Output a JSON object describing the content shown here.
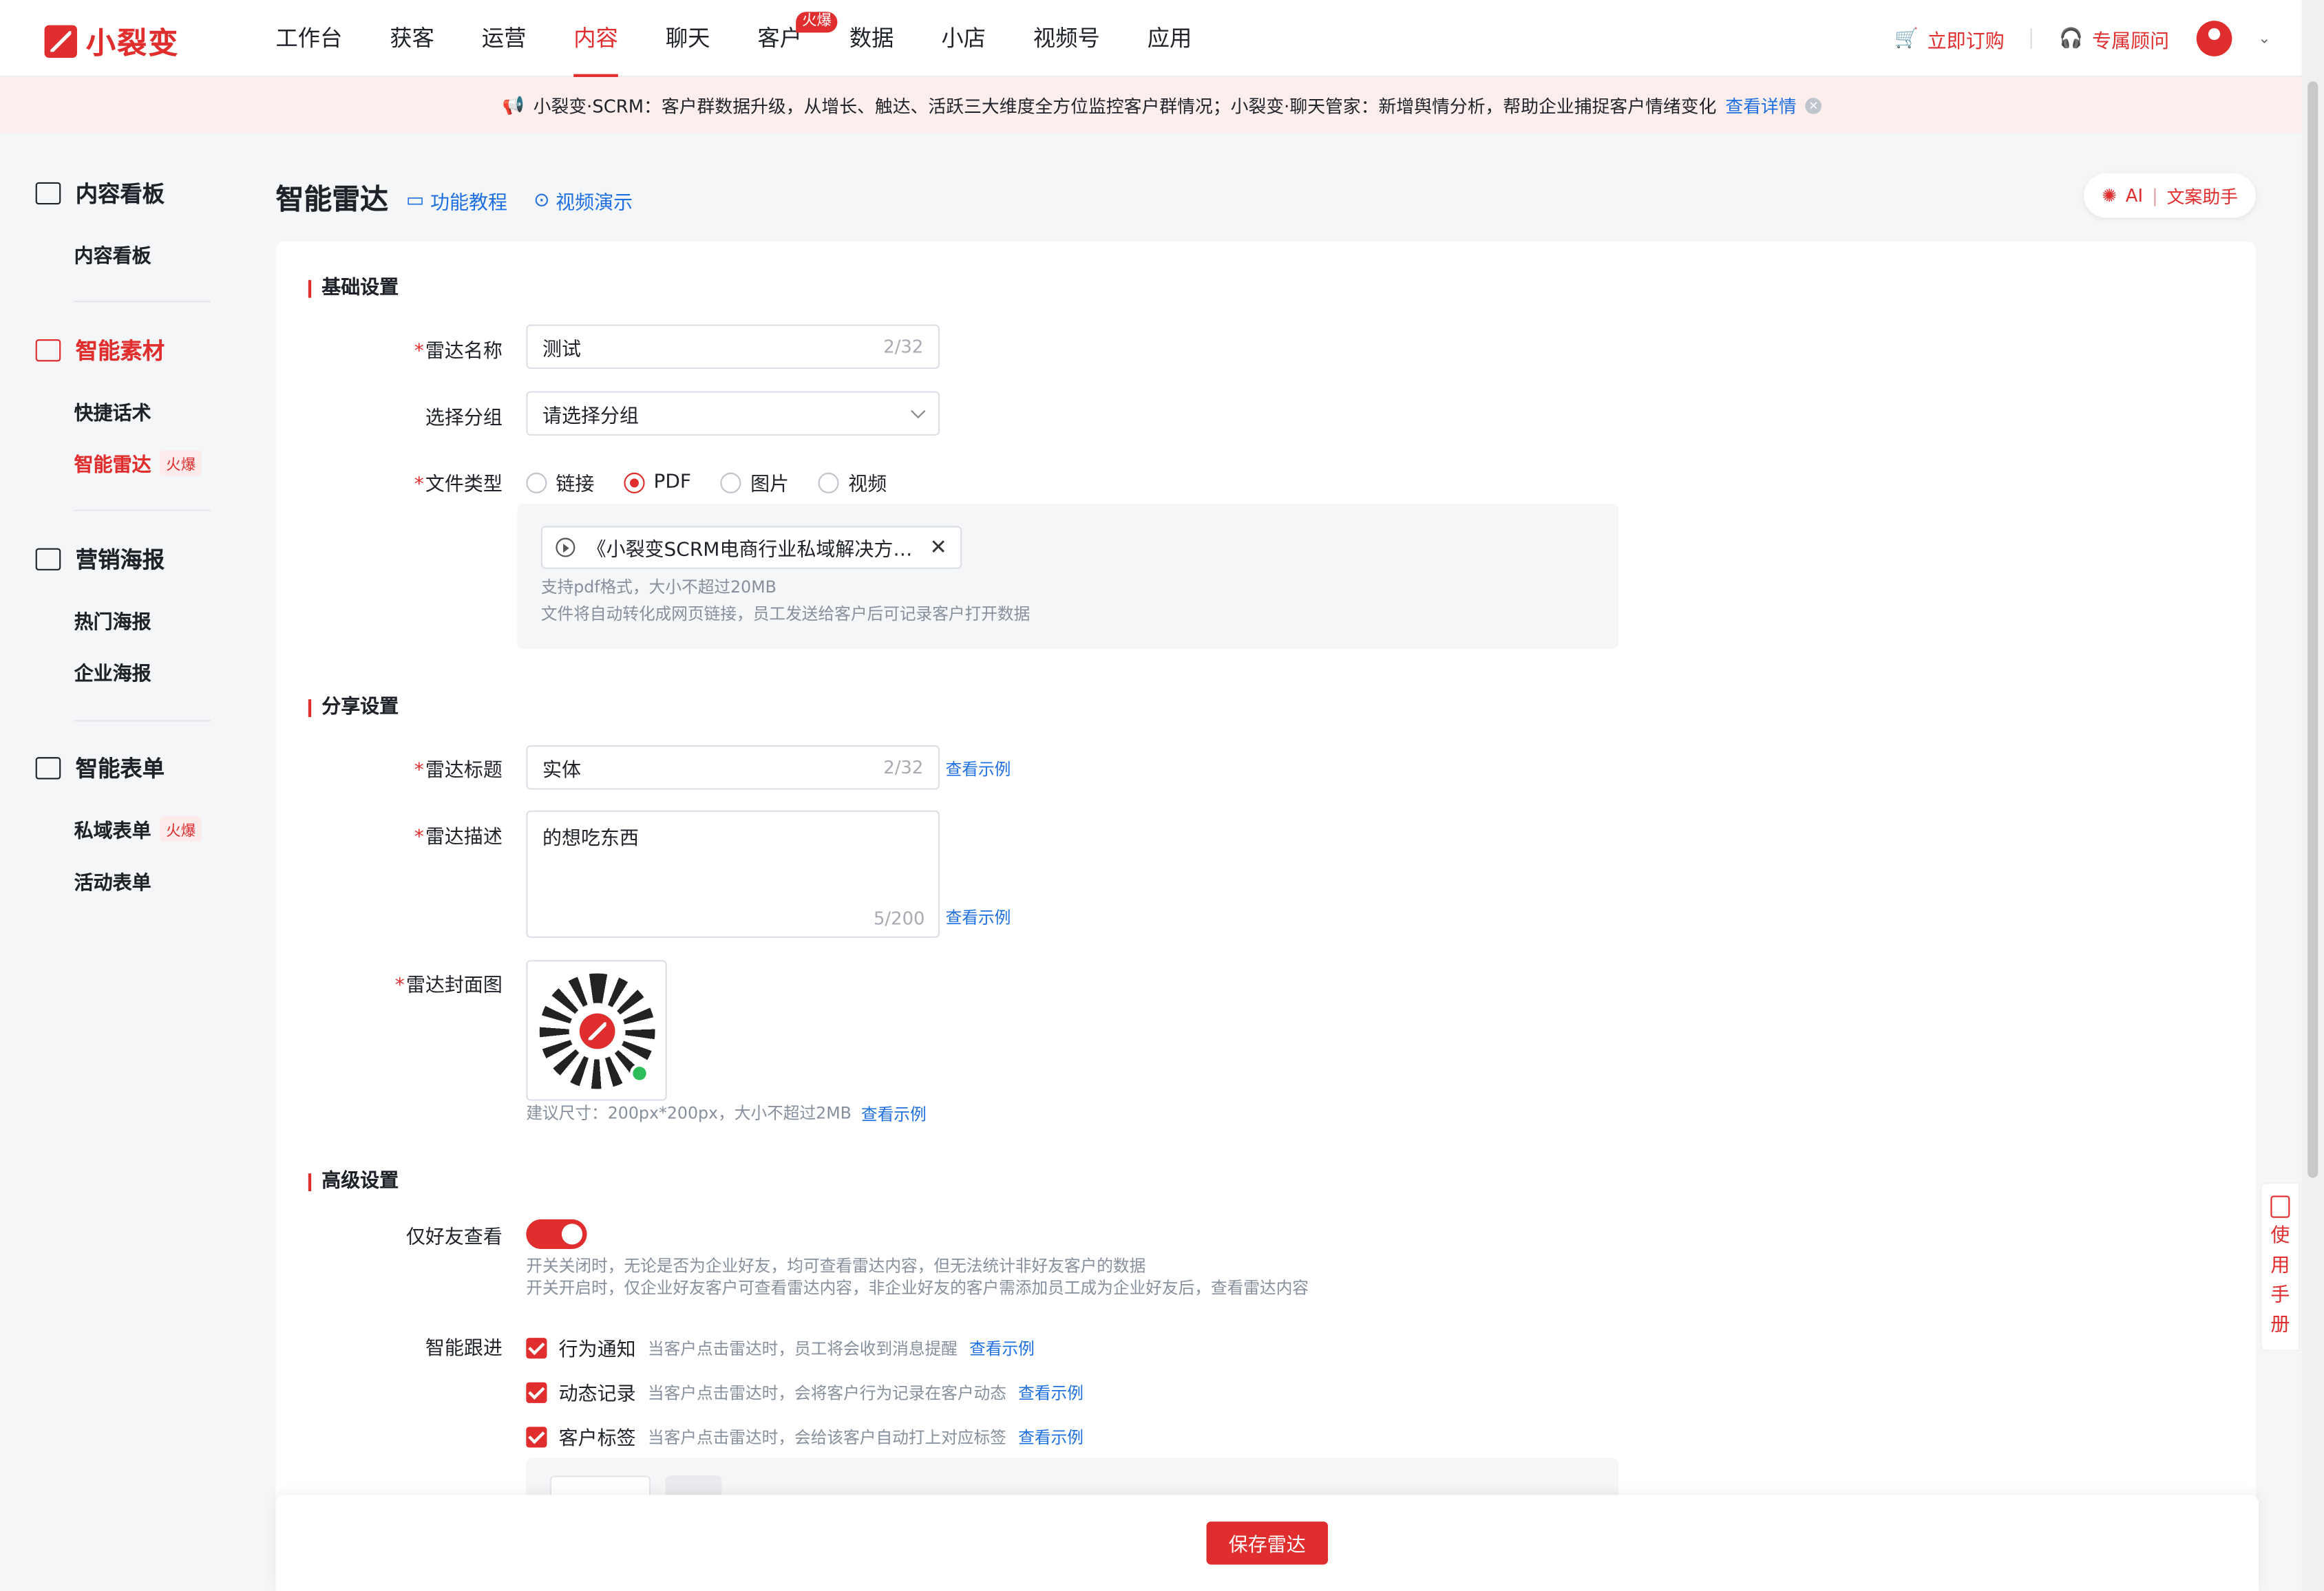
{
  "brand": {
    "name": "小裂变"
  },
  "nav": {
    "items": [
      "工作台",
      "获客",
      "运营",
      "内容",
      "聊天",
      "客户",
      "数据",
      "小店",
      "视频号",
      "应用"
    ],
    "active_index": 3,
    "hot_badge": "火爆"
  },
  "top_right": {
    "order": "立即订购",
    "advisor": "专属顾问"
  },
  "notice": {
    "text": "小裂变·SCRM：客户群数据升级，从增长、触达、活跃三大维度全方位监控客户群情况；小裂变·聊天管家：新增舆情分析，帮助企业捕捉客户情绪变化",
    "link": "查看详情"
  },
  "sidebar": {
    "groups": [
      {
        "label": "内容看板",
        "items": [
          "内容看板"
        ]
      },
      {
        "label": "智能素材",
        "items": [
          "快捷话术",
          "智能雷达"
        ]
      },
      {
        "label": "营销海报",
        "items": [
          "热门海报",
          "企业海报"
        ]
      },
      {
        "label": "智能表单",
        "items": [
          "私域表单",
          "活动表单"
        ]
      }
    ],
    "hot": "火爆"
  },
  "header": {
    "title": "智能雷达",
    "tutorial": "功能教程",
    "video": "视频演示",
    "ai_label": "AI",
    "ai_sub": "文案助手"
  },
  "form": {
    "basic": {
      "title": "基础设置",
      "name_label": "雷达名称",
      "name_value": "测试",
      "name_count": "2/32",
      "group_label": "选择分组",
      "group_placeholder": "请选择分组",
      "type_label": "文件类型",
      "types": [
        "链接",
        "PDF",
        "图片",
        "视频"
      ],
      "type_selected": "PDF",
      "file_name": "《小裂变SCRM电商行业私域解决方案》",
      "file_hint1": "支持pdf格式，大小不超过20MB",
      "file_hint2": "文件将自动转化成网页链接，员工发送给客户后可记录客户打开数据"
    },
    "share": {
      "title": "分享设置",
      "title_label": "雷达标题",
      "title_value": "实体",
      "title_count": "2/32",
      "desc_label": "雷达描述",
      "desc_value": "的想吃东西",
      "desc_count": "5/200",
      "cover_label": "雷达封面图",
      "cover_hint": "建议尺寸：200px*200px，大小不超过2MB",
      "see_example": "查看示例"
    },
    "advanced": {
      "title": "高级设置",
      "friends_label": "仅好友查看",
      "friends_on": true,
      "friends_hint1": "开关关闭时，无论是否为企业好友，均可查看雷达内容，但无法统计非好友客户的数据",
      "friends_hint2": "开关开启时，仅企业好友客户可查看雷达内容，非企业好友的客户需添加员工成为企业好友后，查看雷达内容",
      "follow_label": "智能跟进",
      "follow": [
        {
          "label": "行为通知",
          "desc": "当客户点击雷达时，员工将会收到消息提醒"
        },
        {
          "label": "动态记录",
          "desc": "当客户点击雷达时，会将客户行为记录在客户动态"
        },
        {
          "label": "客户标签",
          "desc": "当客户点击雷达时，会给该客户自动打上对应标签"
        }
      ]
    }
  },
  "footer": {
    "save": "保存雷达"
  },
  "handbook": [
    "使",
    "用",
    "手",
    "册"
  ]
}
